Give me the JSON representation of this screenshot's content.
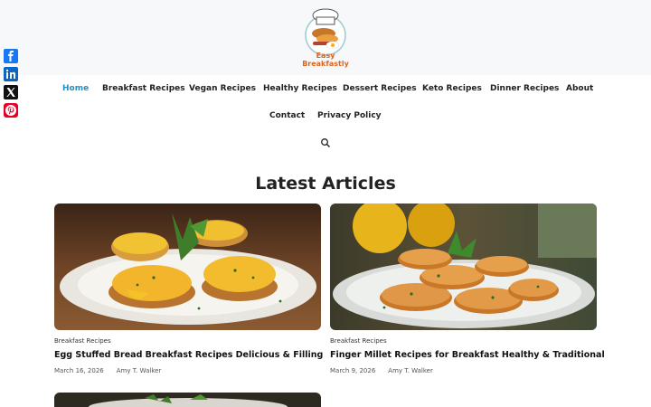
{
  "site": {
    "logo_line1": "Easy",
    "logo_line2": "Breakfastly",
    "logo_icon": "chef-hat-breakfast-logo"
  },
  "nav": {
    "items": [
      {
        "label": "Home",
        "active": true
      },
      {
        "label": "Breakfast Recipes"
      },
      {
        "label": "Vegan Recipes"
      },
      {
        "label": "Healthy Recipes"
      },
      {
        "label": "Dessert Recipes"
      },
      {
        "label": "Keto Recipes"
      },
      {
        "label": "Dinner Recipes"
      },
      {
        "label": "About"
      },
      {
        "label": "Contact"
      },
      {
        "label": "Privacy Policy",
        "has_dropdown": true
      }
    ],
    "search_icon": "search-icon",
    "active_color": "#1e90c8"
  },
  "share": [
    {
      "name": "facebook",
      "color": "#1877f2"
    },
    {
      "name": "linkedin",
      "color": "#0a66c2"
    },
    {
      "name": "x",
      "color": "#111111"
    },
    {
      "name": "pinterest",
      "color": "#e60023"
    }
  ],
  "main": {
    "section_title": "Latest Articles",
    "articles": [
      {
        "category": "Breakfast Recipes",
        "title": "Egg Stuffed Bread Breakfast Recipes Delicious & Filling",
        "date": "March 16, 2026",
        "author": "Amy T. Walker"
      },
      {
        "category": "Breakfast Recipes",
        "title": "Finger Millet Recipes for Breakfast Healthy & Traditional",
        "date": "March 9, 2026",
        "author": "Amy T. Walker"
      }
    ]
  }
}
